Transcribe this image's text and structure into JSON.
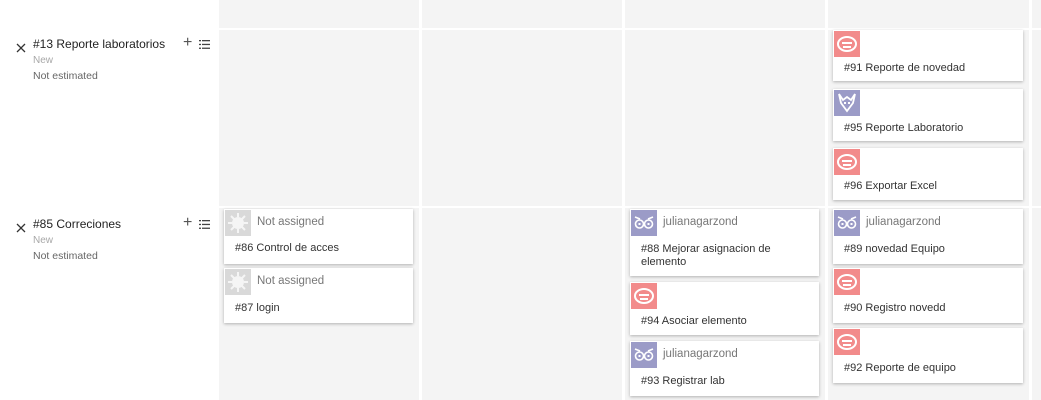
{
  "stories": [
    {
      "title": "#13 Reporte laboratorios",
      "state": "New",
      "estimate": "Not estimated"
    },
    {
      "title": "#85 Correciones",
      "state": "New",
      "estimate": "Not estimated"
    }
  ],
  "cards": {
    "c91": {
      "owner": "",
      "title": "#91 Reporte de novedad",
      "avatar": "pink-avatar"
    },
    "c95": {
      "owner": "",
      "title": "#95 Reporte Laboratorio",
      "avatar": "lavender-avatar"
    },
    "c96": {
      "owner": "",
      "title": "#96 Exportar Excel",
      "avatar": "pink-avatar"
    },
    "c86": {
      "owner": "Not assigned",
      "title": "#86 Control de acces",
      "avatar": "gray-avatar"
    },
    "c87": {
      "owner": "Not assigned",
      "title": "#87 login",
      "avatar": "gray-avatar"
    },
    "c88": {
      "owner": "julianagarzond",
      "title": "#88 Mejorar asignacion de elemento",
      "avatar": "owl-avatar"
    },
    "c94": {
      "owner": "",
      "title": "#94 Asociar elemento",
      "avatar": "pink-avatar"
    },
    "c93": {
      "owner": "julianagarzond",
      "title": "#93 Registrar lab",
      "avatar": "owl-avatar"
    },
    "c89": {
      "owner": "julianagarzond",
      "title": "#89 novedad Equipo",
      "avatar": "owl-avatar"
    },
    "c90": {
      "owner": "",
      "title": "#90 Registro novedd",
      "avatar": "pink-avatar"
    },
    "c92": {
      "owner": "",
      "title": "#92 Reporte de equipo",
      "avatar": "pink-avatar"
    }
  },
  "colors": {
    "column_bg": "#f4f4f4",
    "pink": "#f28b8b",
    "lavender": "#9b9bc7",
    "gray": "#d9d9d9"
  }
}
